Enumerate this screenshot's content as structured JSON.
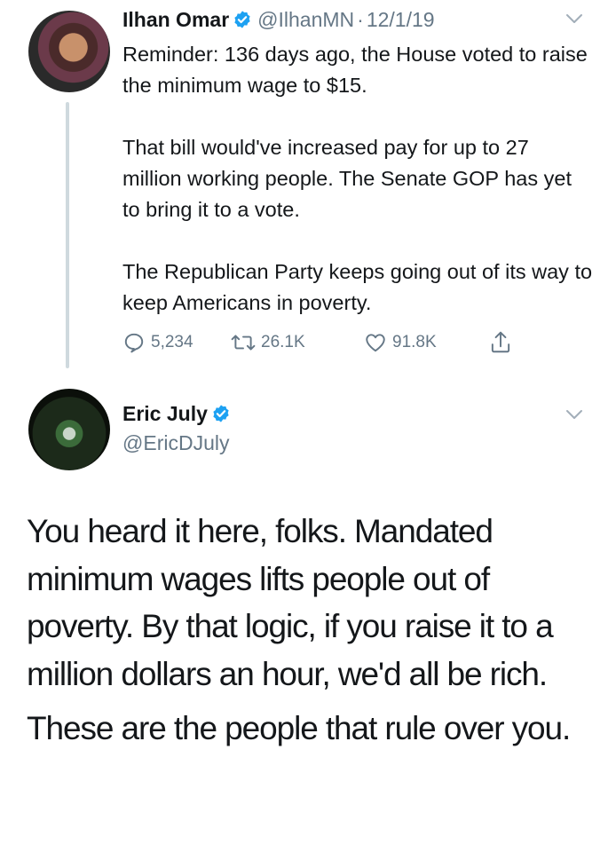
{
  "tweet1": {
    "author_name": "Ilhan Omar",
    "handle": "@IlhanMN",
    "separator": "·",
    "date": "12/1/19",
    "paragraphs": [
      "Reminder: 136 days ago, the House voted to raise the minimum wage to $15.",
      "That bill would've increased pay for up to 27 million working people. The Senate GOP has yet to bring it to a vote.",
      "The Republican Party keeps going out of its way to keep Americans in poverty."
    ],
    "replies": "5,234",
    "retweets": "26.1K",
    "likes": "91.8K",
    "icons": {
      "reply": "reply-icon",
      "retweet": "retweet-icon",
      "like": "heart-icon",
      "share": "share-icon",
      "menu": "chevron-down-icon",
      "verified": "verified-badge-icon"
    }
  },
  "tweet2": {
    "author_name": "Eric July",
    "handle": "@EricDJuly",
    "paragraphs": [
      "You heard it here, folks. Mandated minimum wages lifts people out of poverty. By that logic, if you raise it to a million dollars an hour, we'd all be rich.",
      "These are the people that rule over you."
    ]
  },
  "colors": {
    "text": "#14171a",
    "secondary": "#657786",
    "verified": "#1da1f2",
    "thread_line": "#cfd9de"
  }
}
